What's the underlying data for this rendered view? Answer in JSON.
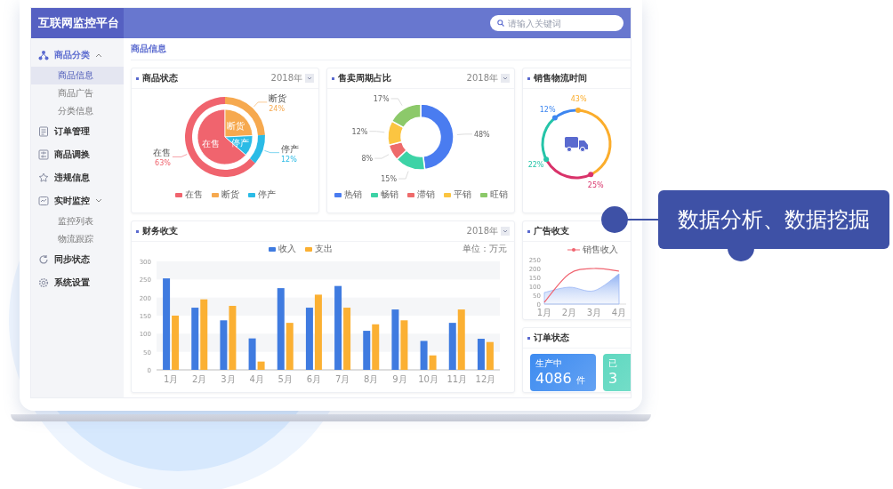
{
  "header": {
    "title": "互联网监控平台",
    "search": {
      "placeholder": "请输入关键词"
    }
  },
  "sidebar": {
    "items": [
      {
        "label": "商品分类",
        "selected": false,
        "expanded": true,
        "children": [
          {
            "label": "商品信息",
            "selected": true
          },
          {
            "label": "商品广告",
            "selected": false
          },
          {
            "label": "分类信息",
            "selected": false
          }
        ]
      },
      {
        "label": "订单管理",
        "selected": false
      },
      {
        "label": "商品调换",
        "selected": false
      },
      {
        "label": "违规信息",
        "selected": false
      },
      {
        "label": "实时监控",
        "selected": false,
        "expanded": false,
        "children": [
          {
            "label": "监控列表",
            "selected": false
          },
          {
            "label": "物流跟踪",
            "selected": false
          }
        ]
      },
      {
        "label": "同步状态",
        "selected": false
      },
      {
        "label": "系统设置",
        "selected": false
      }
    ]
  },
  "breadcrumb": "商品信息",
  "product_status": {
    "title": "商品状态",
    "year": "2018年",
    "chart_data": {
      "type": "donut",
      "categories": [
        "在售",
        "断货",
        "停产"
      ],
      "series": [
        {
          "values": [
            63,
            24,
            12
          ]
        },
        {
          "values": [
            63,
            24,
            12
          ]
        }
      ],
      "colors": [
        "#f0646e",
        "#f6a94f",
        "#2bbbe6"
      ],
      "value_labels": [
        "63%",
        "24%",
        "12%"
      ]
    },
    "inner_labels": [
      "在售",
      "断货",
      "停产"
    ],
    "callout_labels": [
      "在售",
      "断货",
      "停产"
    ]
  },
  "sales_cycle": {
    "title": "售卖周期占比",
    "year": "2018年",
    "chart_data": {
      "type": "donut",
      "categories": [
        "热销",
        "畅销",
        "滞销",
        "平销",
        "旺销"
      ],
      "values": [
        48,
        15,
        8,
        12,
        17
      ],
      "colors": [
        "#4a7cf0",
        "#3dd3a6",
        "#ee6b6b",
        "#fbc541",
        "#8cc96a"
      ],
      "value_labels": [
        "48%",
        "15%",
        "8%",
        "12%",
        "17%"
      ]
    }
  },
  "logistics": {
    "title": "销售物流时间",
    "chart_data": {
      "type": "donut",
      "values": [
        12,
        43,
        25,
        22
      ],
      "colors": [
        "#3d86f0",
        "#fbad2c",
        "#d9336a",
        "#25c4a8"
      ],
      "value_labels": [
        "12%",
        "43%",
        "25%",
        "22%"
      ]
    }
  },
  "finance": {
    "title": "财务收支",
    "year": "2018年",
    "unit": "单位：万元",
    "chart_data": {
      "type": "bar",
      "categories": [
        "1月",
        "2月",
        "3月",
        "4月",
        "5月",
        "6月",
        "7月",
        "8月",
        "9月",
        "10月",
        "11月",
        "12月"
      ],
      "series": [
        {
          "name": "收入",
          "color": "#3f7be0",
          "values": [
            253,
            172,
            137,
            87,
            226,
            172,
            232,
            108,
            167,
            80,
            130,
            86
          ]
        },
        {
          "name": "支出",
          "color": "#fbb033",
          "values": [
            150,
            195,
            177,
            23,
            130,
            208,
            172,
            126,
            137,
            40,
            167,
            77
          ]
        }
      ],
      "ylim": [
        0,
        300
      ],
      "yticks": [
        0,
        50,
        100,
        150,
        200,
        250,
        300
      ]
    }
  },
  "ads": {
    "title": "广告收支",
    "chart_data": {
      "type": "line",
      "categories": [
        "1月",
        "2月",
        "3月",
        "4月"
      ],
      "series": [
        {
          "name": "销售收入",
          "color": "#f06470",
          "values": [
            10,
            170,
            200,
            185
          ]
        },
        {
          "type": "area",
          "color": "#9db8f5",
          "values": [
            65,
            95,
            75,
            170
          ]
        }
      ],
      "ylim": [
        0,
        250
      ],
      "yticks": [
        0,
        50,
        100,
        150,
        200,
        250
      ]
    }
  },
  "orders": {
    "title": "订单状态",
    "tiles": [
      {
        "label": "生产中",
        "value": "4086",
        "unit": "件",
        "color": "#3d8bf0"
      },
      {
        "label": "已",
        "value": "3",
        "color": "#5fd8c0"
      }
    ]
  },
  "callout": {
    "text": "数据分析、数据挖掘"
  }
}
